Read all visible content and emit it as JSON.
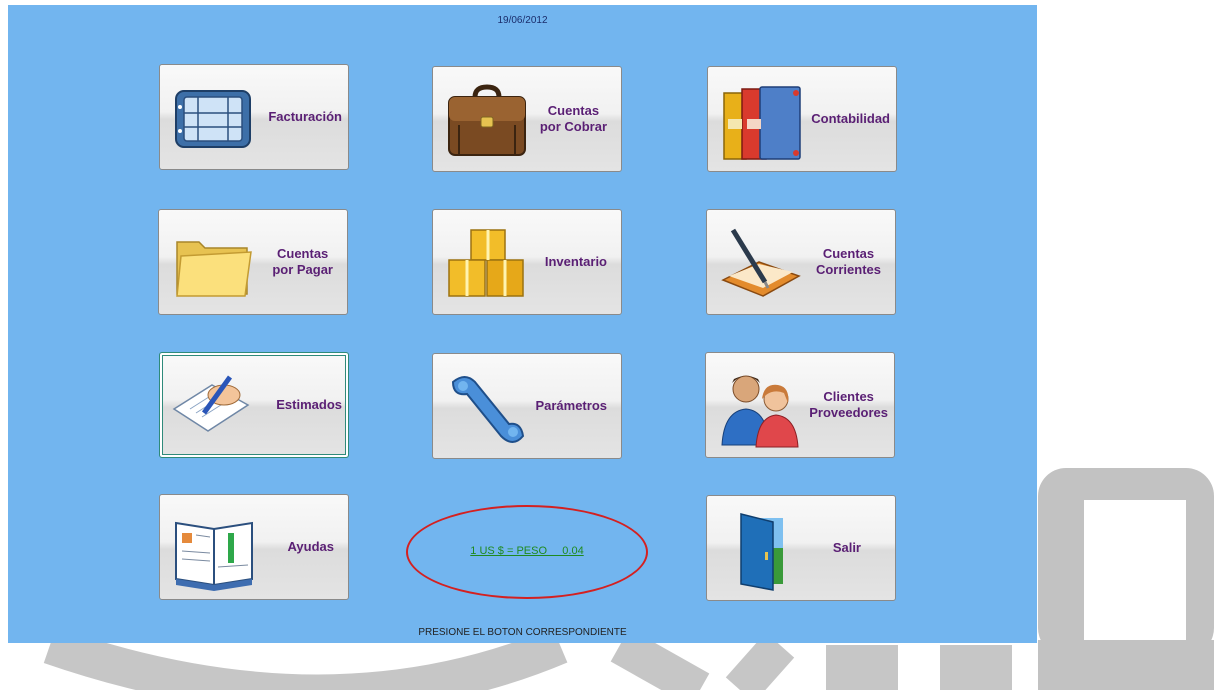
{
  "header": {
    "date": "19/06/2012"
  },
  "buttons": {
    "facturacion": {
      "label": "Facturación",
      "icon": "invoice-icon"
    },
    "cuentas_por_cobrar": {
      "line1": "Cuentas",
      "line2": "por Cobrar",
      "icon": "briefcase-icon"
    },
    "contabilidad": {
      "label": "Contabilidad",
      "icon": "binders-icon"
    },
    "cuentas_por_pagar": {
      "line1": "Cuentas",
      "line2": "por Pagar",
      "icon": "folder-icon"
    },
    "inventario": {
      "label": "Inventario",
      "icon": "boxes-icon"
    },
    "cuentas_corrientes": {
      "line1": "Cuentas",
      "line2": "Corrientes",
      "icon": "checkbook-icon"
    },
    "estimados": {
      "label": "Estimados",
      "icon": "writing-hand-icon"
    },
    "parametros": {
      "label": "Parámetros",
      "icon": "wrench-icon"
    },
    "clientes_proveedores": {
      "line1": "Clientes",
      "line2": "Proveedores",
      "icon": "people-icon"
    },
    "ayudas": {
      "label": "Ayudas",
      "icon": "book-icon"
    },
    "salir": {
      "label": "Salir",
      "icon": "door-icon"
    }
  },
  "exchange_rate": {
    "text": "1 US $ = PESO     0.04"
  },
  "footer": {
    "status": "PRESIONE EL BOTON CORRESPONDIENTE"
  },
  "colors": {
    "panel": "#72b5ef",
    "label": "#5a1f74",
    "rate_link": "#1f8a1f",
    "highlight_ellipse": "#d42020"
  }
}
